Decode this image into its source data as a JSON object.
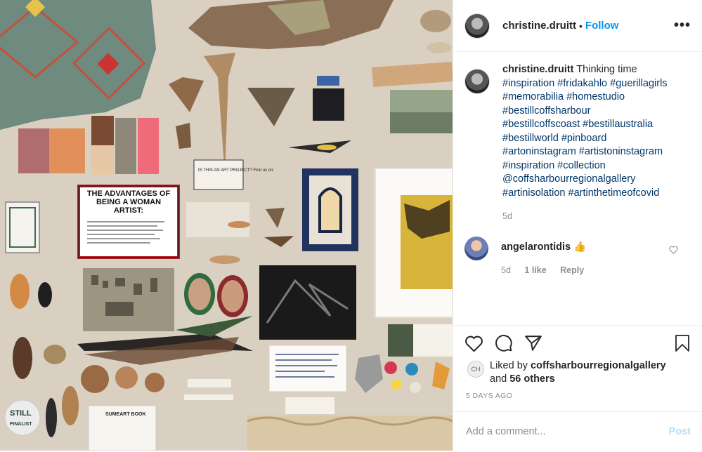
{
  "header": {
    "username": "christine.druitt",
    "separator": "•",
    "follow_label": "Follow",
    "more_label": "•••"
  },
  "caption": {
    "username": "christine.druitt",
    "text": "Thinking time",
    "tags": [
      "#inspiration #fridakahlo #guerillagirls",
      "#memorabilia #homestudio",
      "#bestillcoffsharbour",
      "#bestillcoffscoast #bestillaustralia",
      "#bestillworld #pinboard",
      "#artoninstagram #artistoninstagram",
      "#inspiration #collection",
      "@coffsharbourregionalgallery",
      "#artinisolation #artinthetimeofcovid"
    ],
    "time": "5d"
  },
  "comment": {
    "username": "angelarontidis",
    "text": "👍",
    "time": "5d",
    "likes": "1 like",
    "reply_label": "Reply"
  },
  "likes": {
    "prefix": "Liked by",
    "user": "coffsharbourregionalgallery",
    "and_text": "and",
    "others": "56 others",
    "avatar_text": "CH"
  },
  "post_date": "5 DAYS AGO",
  "add_comment": {
    "placeholder": "Add a comment...",
    "post_label": "Post"
  },
  "photo": {
    "poster_title": "THE ADVANTAGES OF BEING A WOMAN ARTIST:",
    "sign_text": "IS THIS AN ART PROJECT? Find us on:",
    "badge_text": "STILL FINALIST",
    "card_title": "SUMEART BOOK"
  }
}
